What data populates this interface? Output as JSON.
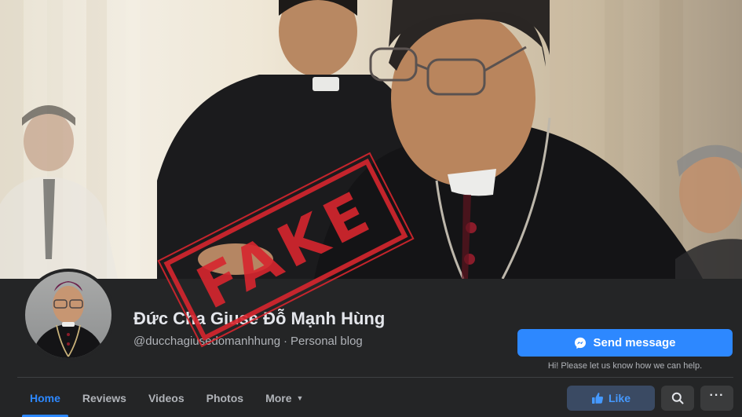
{
  "cover": {
    "stamp_text": "FAKE"
  },
  "profile": {
    "name": "Đức Cha Giuse Đỗ Mạnh Hùng",
    "handle": "@ducchagiusedomanhhung",
    "separator": "·",
    "category": "Personal blog"
  },
  "actions": {
    "send_message_label": "Send message",
    "help_text": "Hi! Please let us know how we can help.",
    "like_label": "Like",
    "more_dots": "···"
  },
  "tabs": [
    {
      "label": "Home",
      "active": true
    },
    {
      "label": "Reviews",
      "active": false
    },
    {
      "label": "Videos",
      "active": false
    },
    {
      "label": "Photos",
      "active": false
    },
    {
      "label": "More",
      "active": false,
      "caret": "▼"
    }
  ],
  "colors": {
    "background": "#242526",
    "accent": "#2d88ff",
    "stamp": "#d7262e"
  },
  "icons": [
    "messenger-icon",
    "thumbs-up-icon",
    "search-icon",
    "more-dots-icon",
    "chevron-down-icon"
  ]
}
